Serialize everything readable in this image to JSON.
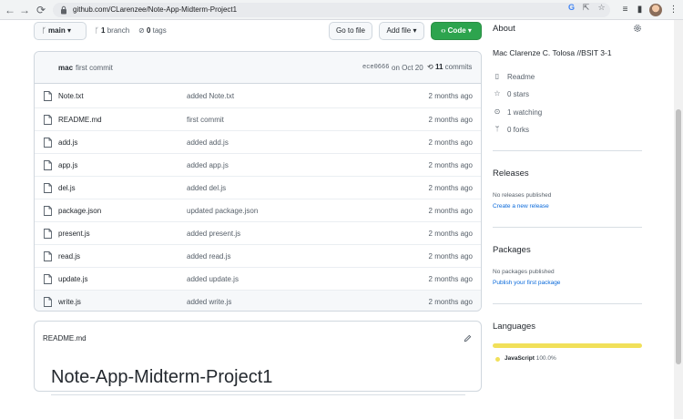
{
  "browser": {
    "back_glyph": "←",
    "forward_glyph": "→",
    "reload_glyph": "⟳",
    "url": "github.com/CLarenzee/Note-App-Midterm-Project1",
    "omnibox_icons": [
      "G",
      "⇱",
      "☆"
    ],
    "toolbar_icons": [
      "≡",
      "▮",
      "⋮"
    ]
  },
  "repo_toolbar": {
    "branch_select": "main",
    "branch_count": "1",
    "branch_label": "branch",
    "tag_count": "0",
    "tag_label": "tags",
    "go_to_file": "Go to file",
    "add_file": "Add file",
    "code": "Code"
  },
  "latest_commit": {
    "author": "mac",
    "message": "first commit",
    "hash": "ece0666",
    "date": "on Oct 20",
    "commit_count": "11",
    "commit_label": "commits"
  },
  "files": [
    {
      "name": "Note.txt",
      "message": "added Note.txt",
      "age": "2 months ago"
    },
    {
      "name": "README.md",
      "message": "first commit",
      "age": "2 months ago"
    },
    {
      "name": "add.js",
      "message": "added add.js",
      "age": "2 months ago"
    },
    {
      "name": "app.js",
      "message": "added app.js",
      "age": "2 months ago"
    },
    {
      "name": "del.js",
      "message": "added del.js",
      "age": "2 months ago"
    },
    {
      "name": "package.json",
      "message": "updated package.json",
      "age": "2 months ago"
    },
    {
      "name": "present.js",
      "message": "added present.js",
      "age": "2 months ago"
    },
    {
      "name": "read.js",
      "message": "added read.js",
      "age": "2 months ago"
    },
    {
      "name": "update.js",
      "message": "added update.js",
      "age": "2 months ago"
    },
    {
      "name": "write.js",
      "message": "added write.js",
      "age": "2 months ago"
    }
  ],
  "readme": {
    "filename": "README.md",
    "title": "Note-App-Midterm-Project1"
  },
  "about": {
    "heading": "About",
    "description": "Mac Clarenze C. Tolosa //BSIT 3-1",
    "readme_link": "Readme",
    "stars": "0 stars",
    "watching": "1 watching",
    "forks": "0 forks"
  },
  "releases": {
    "heading": "Releases",
    "empty_text": "No releases published",
    "create_link": "Create a new release"
  },
  "packages": {
    "heading": "Packages",
    "empty_text": "No packages published",
    "publish_link": "Publish your first package"
  },
  "languages": {
    "heading": "Languages",
    "items": [
      {
        "name": "JavaScript",
        "percent": "100.0%",
        "fraction": 1.0,
        "color": "#f1e05a"
      }
    ]
  },
  "colors": {
    "accent_green": "#2da44e",
    "link_blue": "#0969da"
  }
}
